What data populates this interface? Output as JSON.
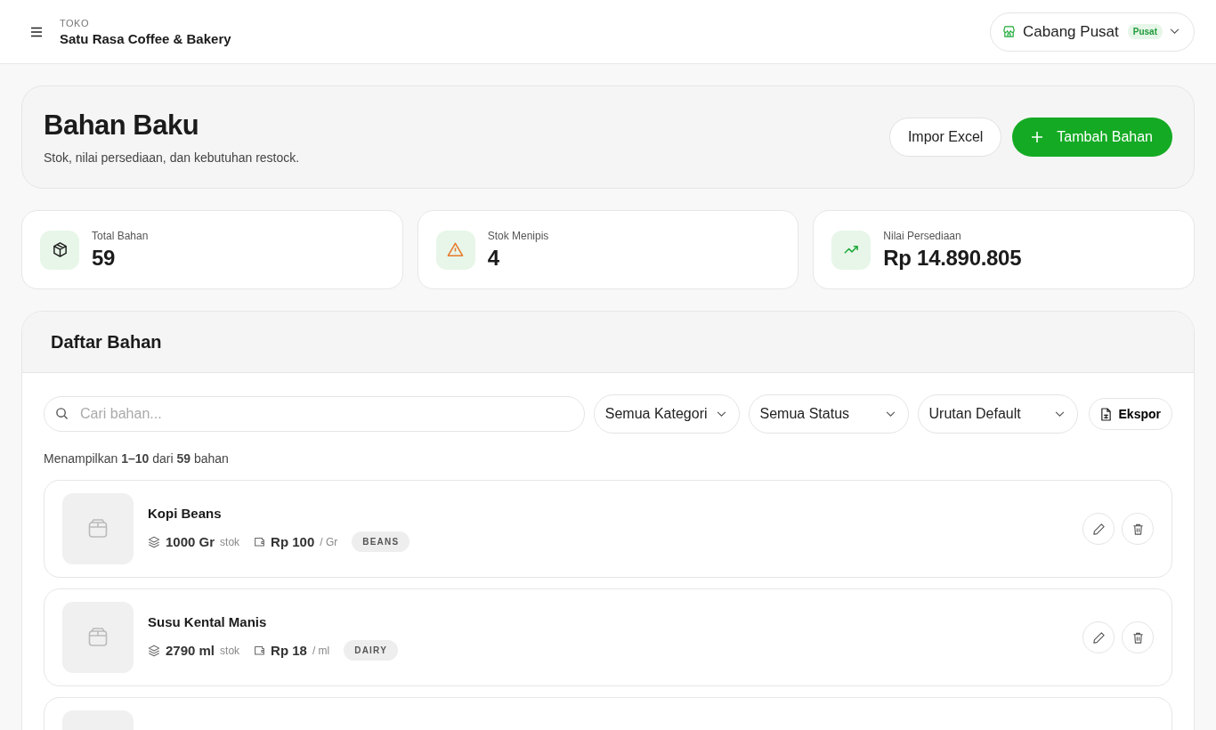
{
  "topbar": {
    "store_label": "TOKO",
    "store_name": "Satu Rasa Coffee & Bakery",
    "branch": {
      "name": "Cabang Pusat",
      "badge": "Pusat"
    }
  },
  "page_header": {
    "title": "Bahan Baku",
    "subtitle": "Stok, nilai persediaan, dan kebutuhan restock.",
    "buttons": [
      {
        "label": "Impor Excel",
        "kind": "secondary"
      },
      {
        "label": "Tambah Bahan",
        "kind": "primary"
      }
    ]
  },
  "stats": [
    {
      "label": "Total Bahan",
      "value": "59",
      "kind": "box"
    },
    {
      "label": "Stok Menipis",
      "value": "4",
      "kind": "warning"
    },
    {
      "label": "Nilai Persediaan",
      "value": "Rp 14.890.805",
      "kind": "trend"
    }
  ],
  "list": {
    "title": "Daftar Bahan",
    "search": {
      "placeholder": "Cari bahan..."
    },
    "filters": [
      {
        "label": "Semua Kategori"
      },
      {
        "label": "Semua Status"
      },
      {
        "label": "Urutan Default"
      }
    ],
    "export_button": "Ekspor",
    "summary": "Menampilkan **1–10** dari **59** bahan",
    "items": [
      {
        "kind": "ingredient",
        "name": "Kopi Beans",
        "stock": "1000 Gr",
        "stock_label": "stok",
        "price": "Rp 100",
        "unit": "/ Gr",
        "category": "BEANS"
      },
      {
        "kind": "ingredient",
        "name": "Susu Kental Manis",
        "stock": "2790 ml",
        "stock_label": "stok",
        "price": "Rp 18",
        "unit": "/ ml",
        "category": "DAIRY"
      },
      {
        "kind": "partial"
      }
    ]
  }
}
